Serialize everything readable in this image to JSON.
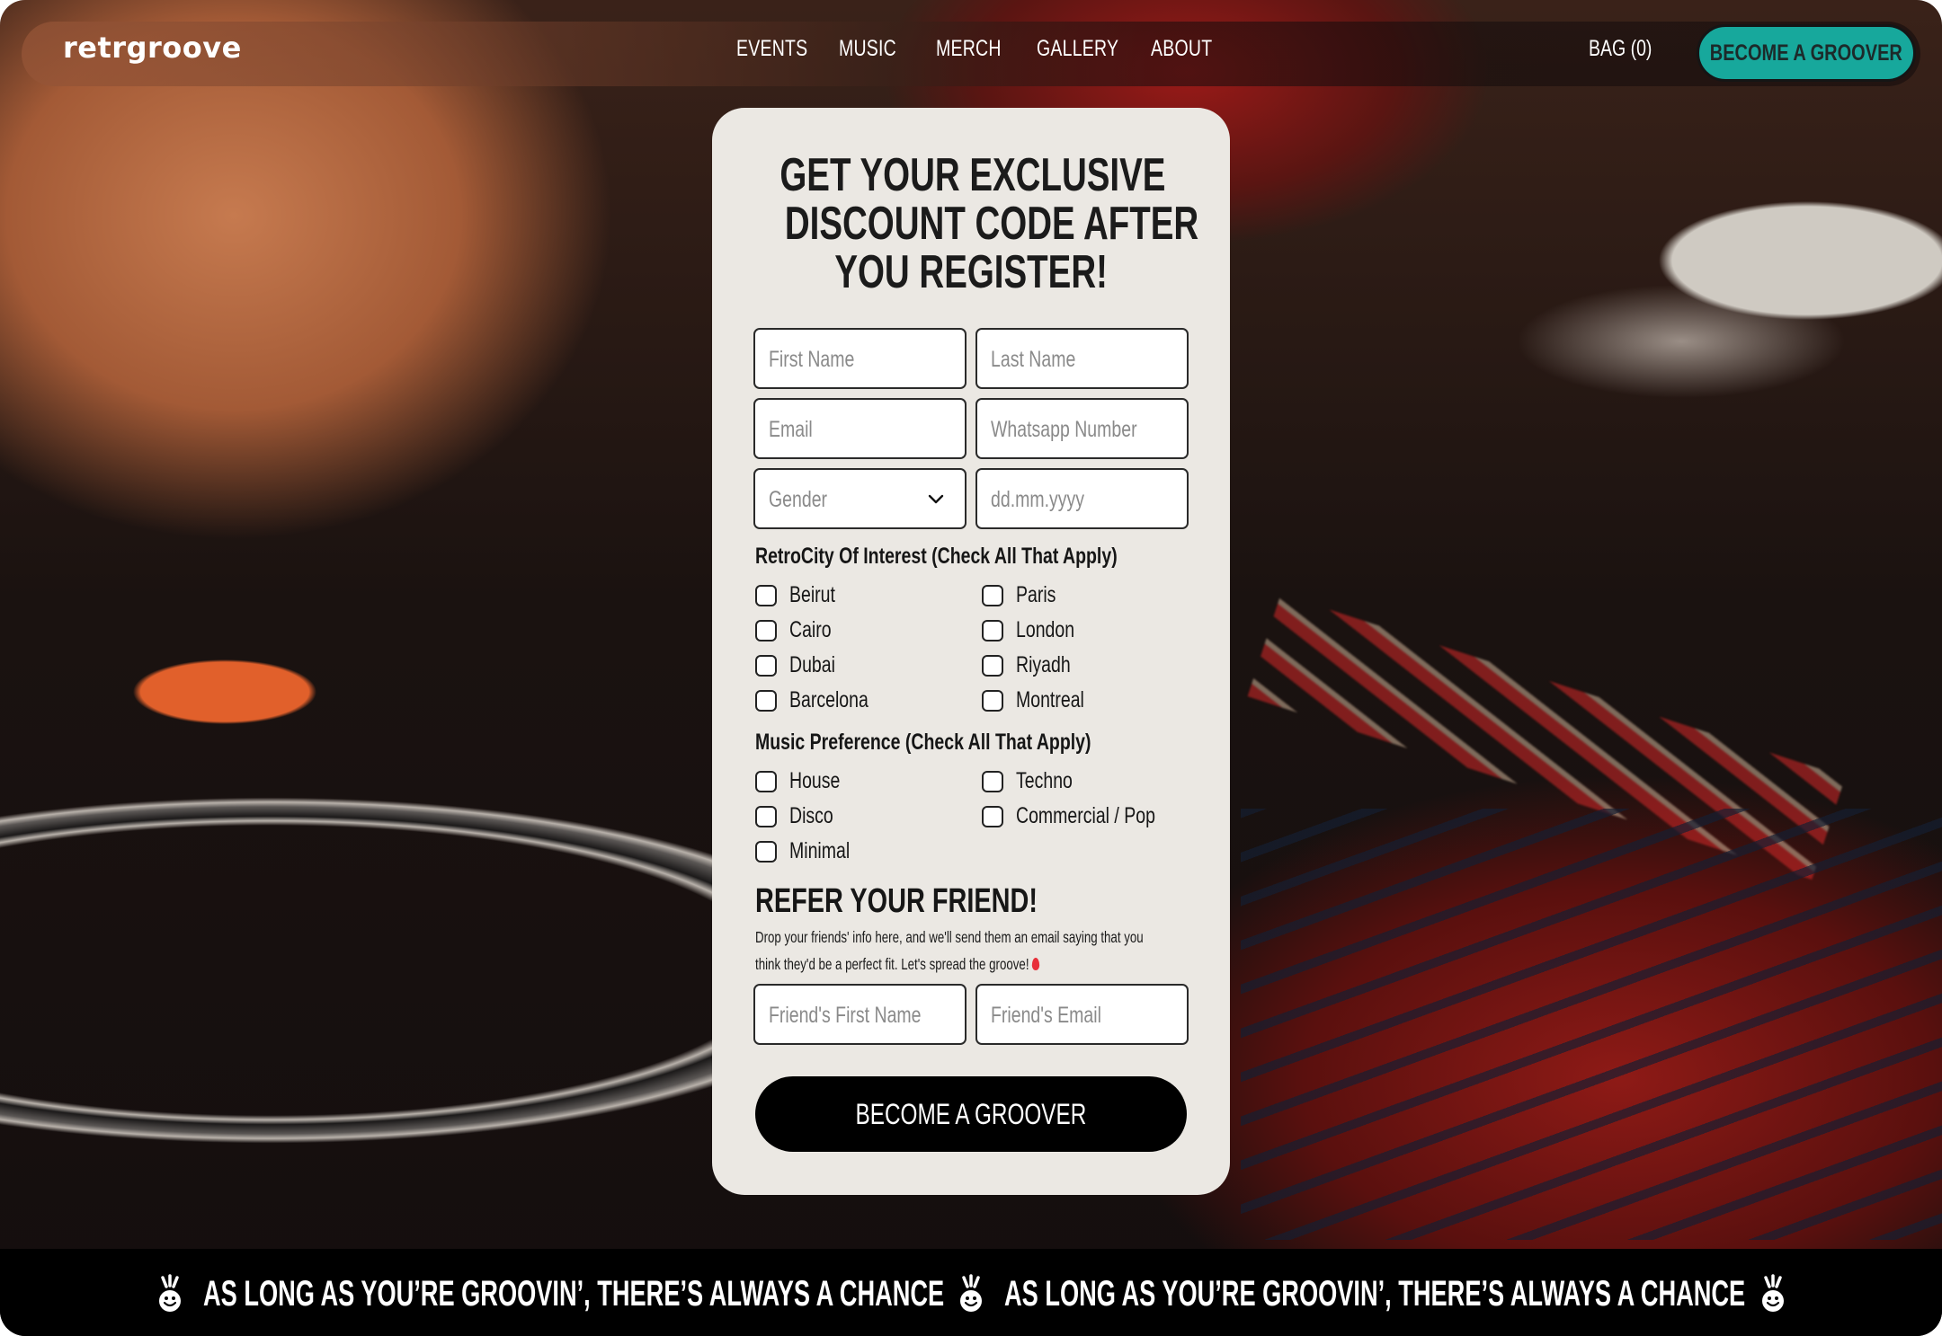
{
  "brand": {
    "logo_text": "retrgroove"
  },
  "nav": {
    "links": [
      "EVENTS",
      "MUSIC",
      "MERCH",
      "GALLERY",
      "ABOUT"
    ],
    "bag_label": "BAG (0)",
    "cta_label": "BECOME A GROOVER"
  },
  "colors": {
    "accent_teal": "#17a89c",
    "card_bg": "#ebe8e3",
    "ticker_bg": "#000000"
  },
  "form": {
    "title_lines": [
      "GET YOUR EXCLUSIVE",
      "DISCOUNT CODE AFTER",
      "YOU REGISTER!"
    ],
    "fields": {
      "first_name_placeholder": "First Name",
      "last_name_placeholder": "Last Name",
      "email_placeholder": "Email",
      "whatsapp_placeholder": "Whatsapp Number",
      "gender_placeholder": "Gender",
      "dob_placeholder": "dd.mm.yyyy"
    },
    "city_group": {
      "label": "RetroCity Of Interest (Check All That Apply)",
      "options": [
        "Beirut",
        "Paris",
        "Cairo",
        "London",
        "Dubai",
        "Riyadh",
        "Barcelona",
        "Montreal"
      ]
    },
    "music_group": {
      "label": "Music Preference (Check All That Apply)",
      "options": [
        "House",
        "Techno",
        "Disco",
        "Commercial / Pop",
        "Minimal"
      ]
    },
    "refer": {
      "title": "REFER YOUR FRIEND!",
      "text_line1": "Drop your friends' info here, and we'll send them an email saying that you",
      "text_line2": "think they'd be a perfect fit. Let's spread the groove!",
      "friend_name_placeholder": "Friend's First Name",
      "friend_email_placeholder": "Friend's Email"
    },
    "submit_label": "BECOME A GROOVER"
  },
  "ticker": {
    "text": "AS LONG AS YOU’RE GROOVIN’, THERE’S ALWAYS A CHANCE",
    "icon": "smiley-icon"
  }
}
